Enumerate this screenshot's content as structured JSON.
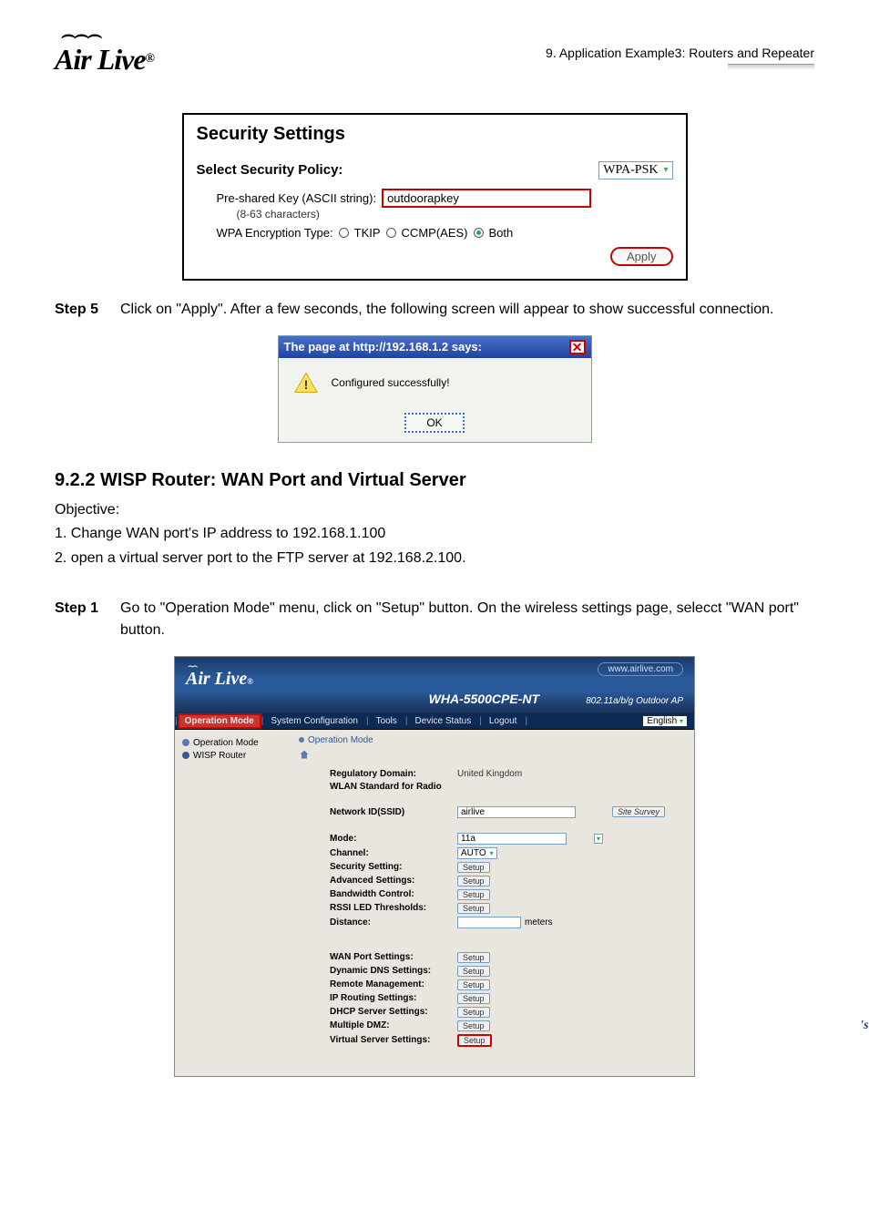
{
  "header": {
    "logo": "Air Live",
    "chapter": "9. Application Example3: Routers and Repeater"
  },
  "security": {
    "title": "Security Settings",
    "select_label": "Select Security Policy:",
    "select_value": "WPA-PSK",
    "psk_label": "Pre-shared Key (ASCII string):",
    "psk_hint": "(8-63 characters)",
    "psk_value": "outdoorapkey",
    "enc_label": "WPA Encryption Type:",
    "enc_opts": [
      "TKIP",
      "CCMP(AES)",
      "Both"
    ],
    "enc_selected": 2,
    "apply": "Apply"
  },
  "step5": {
    "label": "Step 5",
    "text": "Click on \"Apply\".    After a few seconds, the following screen will appear to show successful connection."
  },
  "dialog": {
    "title": "The page at http://192.168.1.2 says:",
    "msg": "Configured successfully!",
    "ok": "OK"
  },
  "section": {
    "heading": "9.2.2 WISP Router: WAN Port and Virtual Server",
    "objective": "Objective:",
    "line1": "1. Change WAN port's IP address to 192.168.1.100",
    "line2": "2. open a virtual server port to the FTP server at 192.168.2.100."
  },
  "step1": {
    "label": "Step 1",
    "text": "Go to \"Operation Mode\" menu, click on \"Setup\" button.    On the wireless settings page, selecct \"WAN port\" button."
  },
  "admin": {
    "url": "www.airlive.com",
    "logo": "Air Live",
    "model": "WHA-5500CPE-NT",
    "subtitle": "802.11a/b/g Outdoor AP",
    "nav": [
      "Operation Mode",
      "System Configuration",
      "Tools",
      "Device Status",
      "Logout"
    ],
    "lang": "English",
    "side": {
      "item1": "Operation Mode",
      "item2": "WISP Router"
    },
    "crumb": "Operation Mode",
    "rows": [
      {
        "label": "Regulatory Domain:",
        "value": "United Kingdom"
      },
      {
        "label": "WLAN Standard for Radio",
        "value": ""
      }
    ],
    "ssid_label": "Network ID(SSID)",
    "ssid_value": "airlive",
    "site_survey": "Site Survey",
    "mode_label": "Mode:",
    "mode_value": "11a",
    "channel_label": "Channel:",
    "channel_value": "AUTO",
    "setup_rows": [
      "Security Setting:",
      "Advanced Settings:",
      "Bandwidth Control:",
      "RSSI LED Thresholds:"
    ],
    "distance_label": "Distance:",
    "distance_unit": "meters",
    "bottom_rows": [
      "WAN Port Settings:",
      "Dynamic DNS Settings:",
      "Remote Management:",
      "IP Routing Settings:",
      "DHCP Server Settings:",
      "Multiple DMZ:",
      "Virtual Server Settings:"
    ],
    "setup_btn": "Setup"
  },
  "footer": {
    "manual": "'ser's Manual"
  }
}
